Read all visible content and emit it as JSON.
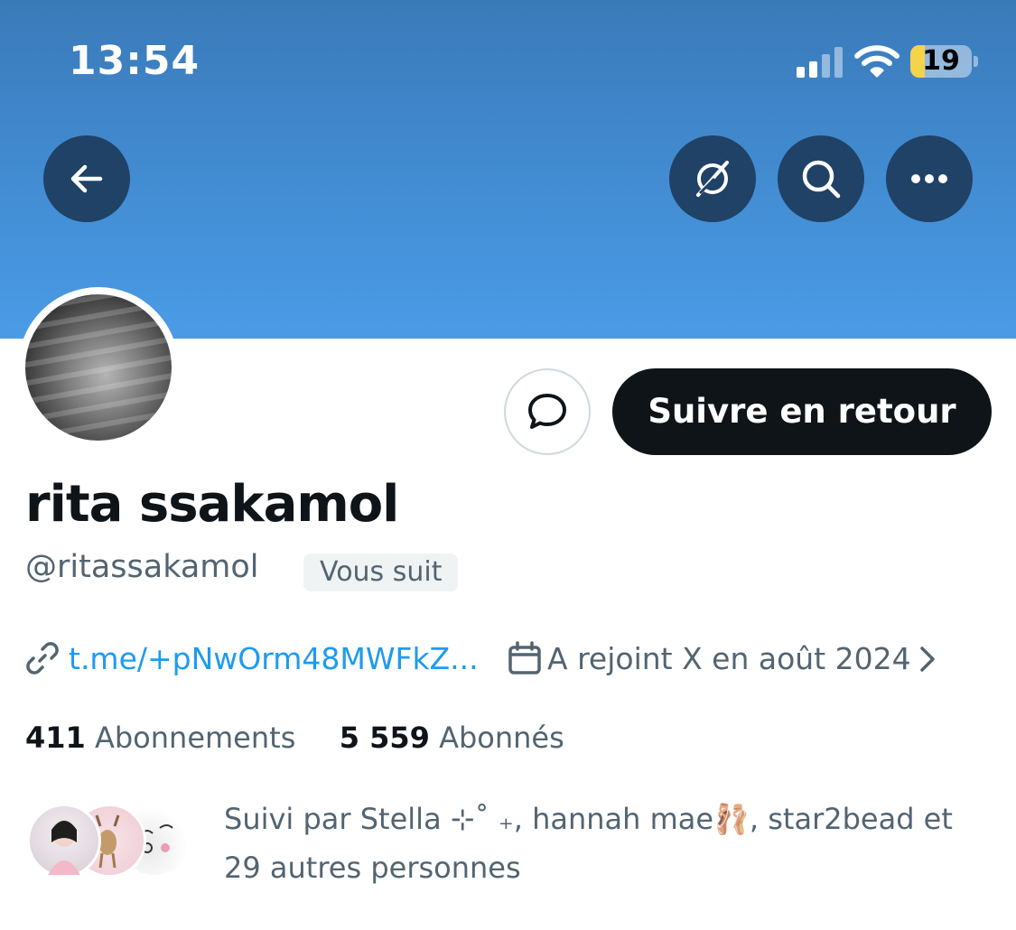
{
  "status_bar": {
    "time": "13:54",
    "battery": "19",
    "icons": [
      "cellular-signal-icon",
      "wifi-icon",
      "battery-icon"
    ]
  },
  "header": {
    "icons": [
      "back-arrow-icon",
      "grok-icon",
      "search-icon",
      "more-icon"
    ],
    "banner_color": "#428bd1"
  },
  "actions": {
    "dm_icon": "message-bubble-icon",
    "follow_label": "Suivre en retour"
  },
  "profile": {
    "display_name": "rita ssakamol",
    "handle": "@ritassakamol",
    "follows_you_badge": "Vous suit",
    "link": "t.me/+pNwOrm48MWFkZ...",
    "joined": "A rejoint X en août 2024",
    "following_count": "411",
    "following_label": "Abonnements",
    "followers_count": "5 559",
    "followers_label": "Abonnés",
    "followed_by_line1": "Suivi par Stella ⊹˚ ₊, hannah mae🩰, star2bead et",
    "followed_by_line2": "29 autres personnes"
  },
  "colors": {
    "accent": "#1d9bf0",
    "secondary_text": "#536471",
    "primary_text": "#0f1419",
    "header_button": "#1f4266"
  }
}
